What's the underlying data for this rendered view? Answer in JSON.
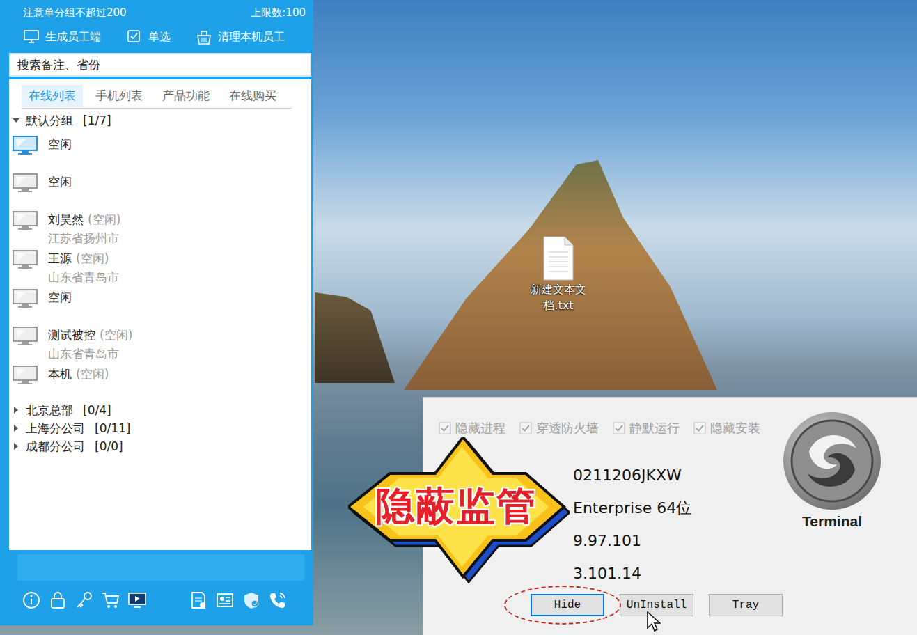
{
  "left_panel": {
    "notice": "注意单分组不超过200",
    "limit": "上限数:100",
    "toolbar": [
      {
        "label": "生成员工端"
      },
      {
        "label": "单选"
      },
      {
        "label": "清理本机员工"
      }
    ],
    "search": {
      "placeholder": "搜索备注、省份"
    },
    "tabs": [
      {
        "label": "在线列表",
        "selected": true
      },
      {
        "label": "手机列表",
        "selected": false
      },
      {
        "label": "产品功能",
        "selected": false
      },
      {
        "label": "在线购买",
        "selected": false
      }
    ],
    "groups": [
      {
        "name": "默认分组",
        "count": "[1/7]",
        "expanded": true,
        "members": [
          {
            "name": "空闲",
            "status": "",
            "region": "",
            "online": true
          },
          {
            "name": "空闲",
            "status": "",
            "region": "",
            "online": false
          },
          {
            "name": "刘昊然",
            "status": "(空闲)",
            "region": "江苏省扬州市",
            "online": false
          },
          {
            "name": "王源",
            "status": "(空闲)",
            "region": "山东省青岛市",
            "online": false
          },
          {
            "name": "空闲",
            "status": "",
            "region": "",
            "online": false
          },
          {
            "name": "测试被控",
            "status": "(空闲)",
            "region": "山东省青岛市",
            "online": false
          },
          {
            "name": "本机",
            "status": "(空闲)",
            "region": "",
            "online": false
          }
        ]
      },
      {
        "name": "北京总部",
        "count": "[0/4]",
        "expanded": false,
        "members": []
      },
      {
        "name": "上海分公司",
        "count": "[0/11]",
        "expanded": false,
        "members": []
      },
      {
        "name": "成都分公司",
        "count": "[0/0]",
        "expanded": false,
        "members": []
      }
    ]
  },
  "desktop": {
    "icons": [
      {
        "label": "新建文本文档.txt"
      }
    ]
  },
  "dialog": {
    "options": [
      {
        "label": "隐藏进程",
        "checked": true,
        "disabled": true
      },
      {
        "label": "穿透防火墙",
        "checked": true,
        "disabled": true
      },
      {
        "label": "静默运行",
        "checked": true,
        "disabled": true
      },
      {
        "label": "隐藏安装",
        "checked": true,
        "disabled": true
      }
    ],
    "info": [
      "0211206JKXW",
      "Enterprise 64位",
      "9.97.101",
      "3.101.14"
    ],
    "logo": "Terminal",
    "buttons": [
      {
        "label": "Hide",
        "focused": true
      },
      {
        "label": "UnInstall",
        "focused": false
      },
      {
        "label": "Tray",
        "focused": false
      }
    ]
  },
  "badge": {
    "text": "隐蔽监管"
  }
}
